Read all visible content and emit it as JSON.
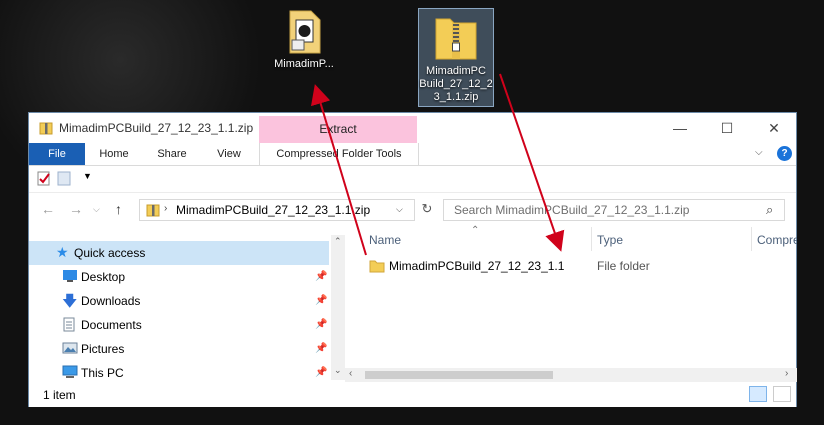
{
  "desktop": {
    "icons": [
      {
        "label": "MimadimP..."
      },
      {
        "label_line1": "MimadimPC",
        "label_line2": "Build_27_12_2",
        "label_line3": "3_1.1.zip"
      }
    ]
  },
  "window": {
    "title": "MimadimPCBuild_27_12_23_1.1.zip",
    "contextual_tab": "Extract",
    "controls": {
      "minimize": "—",
      "maximize": "☐",
      "close": "✕"
    }
  },
  "ribbon": {
    "tabs": [
      "File",
      "Home",
      "Share",
      "View",
      "Compressed Folder Tools"
    ]
  },
  "address": {
    "path": "MimadimPCBuild_27_12_23_1.1.zip",
    "search_placeholder": "Search MimadimPCBuild_27_12_23_1.1.zip"
  },
  "navigation": {
    "items": [
      {
        "label": "Quick access",
        "icon": "star-icon"
      },
      {
        "label": "Desktop",
        "icon": "desktop-icon"
      },
      {
        "label": "Downloads",
        "icon": "download-icon"
      },
      {
        "label": "Documents",
        "icon": "document-icon"
      },
      {
        "label": "Pictures",
        "icon": "pictures-icon"
      },
      {
        "label": "This PC",
        "icon": "computer-icon"
      }
    ]
  },
  "file_list": {
    "columns": [
      "Name",
      "Type",
      "Compre"
    ],
    "rows": [
      {
        "name": "MimadimPCBuild_27_12_23_1.1",
        "type": "File folder"
      }
    ]
  },
  "status": {
    "count": "1 item"
  },
  "colors": {
    "accent": "#1a5fb4",
    "extract_tab": "#fbc3dd",
    "annotation_arrow": "#d0021b"
  }
}
